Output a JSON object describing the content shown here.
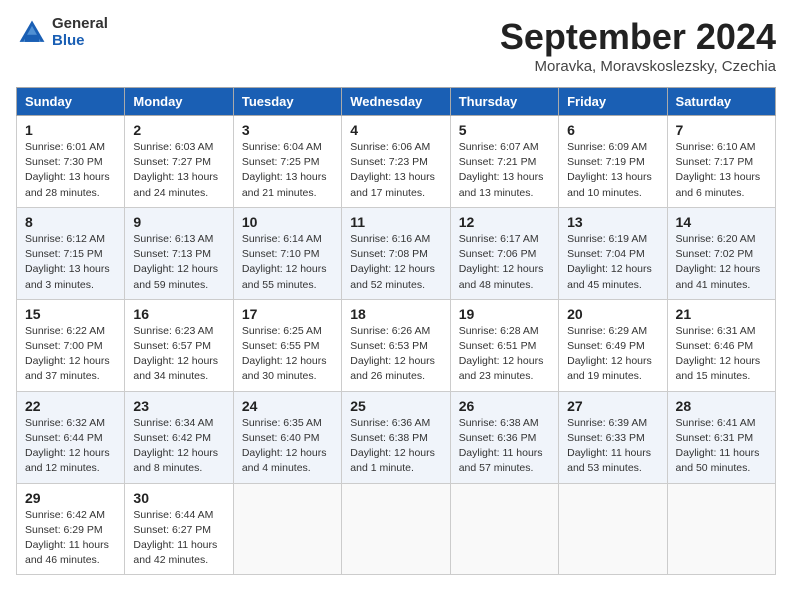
{
  "header": {
    "logo": {
      "general": "General",
      "blue": "Blue"
    },
    "title": "September 2024",
    "location": "Moravka, Moravskoslezsky, Czechia"
  },
  "weekdays": [
    "Sunday",
    "Monday",
    "Tuesday",
    "Wednesday",
    "Thursday",
    "Friday",
    "Saturday"
  ],
  "weeks": [
    [
      {
        "day": "1",
        "info": "Sunrise: 6:01 AM\nSunset: 7:30 PM\nDaylight: 13 hours\nand 28 minutes."
      },
      {
        "day": "2",
        "info": "Sunrise: 6:03 AM\nSunset: 7:27 PM\nDaylight: 13 hours\nand 24 minutes."
      },
      {
        "day": "3",
        "info": "Sunrise: 6:04 AM\nSunset: 7:25 PM\nDaylight: 13 hours\nand 21 minutes."
      },
      {
        "day": "4",
        "info": "Sunrise: 6:06 AM\nSunset: 7:23 PM\nDaylight: 13 hours\nand 17 minutes."
      },
      {
        "day": "5",
        "info": "Sunrise: 6:07 AM\nSunset: 7:21 PM\nDaylight: 13 hours\nand 13 minutes."
      },
      {
        "day": "6",
        "info": "Sunrise: 6:09 AM\nSunset: 7:19 PM\nDaylight: 13 hours\nand 10 minutes."
      },
      {
        "day": "7",
        "info": "Sunrise: 6:10 AM\nSunset: 7:17 PM\nDaylight: 13 hours\nand 6 minutes."
      }
    ],
    [
      {
        "day": "8",
        "info": "Sunrise: 6:12 AM\nSunset: 7:15 PM\nDaylight: 13 hours\nand 3 minutes."
      },
      {
        "day": "9",
        "info": "Sunrise: 6:13 AM\nSunset: 7:13 PM\nDaylight: 12 hours\nand 59 minutes."
      },
      {
        "day": "10",
        "info": "Sunrise: 6:14 AM\nSunset: 7:10 PM\nDaylight: 12 hours\nand 55 minutes."
      },
      {
        "day": "11",
        "info": "Sunrise: 6:16 AM\nSunset: 7:08 PM\nDaylight: 12 hours\nand 52 minutes."
      },
      {
        "day": "12",
        "info": "Sunrise: 6:17 AM\nSunset: 7:06 PM\nDaylight: 12 hours\nand 48 minutes."
      },
      {
        "day": "13",
        "info": "Sunrise: 6:19 AM\nSunset: 7:04 PM\nDaylight: 12 hours\nand 45 minutes."
      },
      {
        "day": "14",
        "info": "Sunrise: 6:20 AM\nSunset: 7:02 PM\nDaylight: 12 hours\nand 41 minutes."
      }
    ],
    [
      {
        "day": "15",
        "info": "Sunrise: 6:22 AM\nSunset: 7:00 PM\nDaylight: 12 hours\nand 37 minutes."
      },
      {
        "day": "16",
        "info": "Sunrise: 6:23 AM\nSunset: 6:57 PM\nDaylight: 12 hours\nand 34 minutes."
      },
      {
        "day": "17",
        "info": "Sunrise: 6:25 AM\nSunset: 6:55 PM\nDaylight: 12 hours\nand 30 minutes."
      },
      {
        "day": "18",
        "info": "Sunrise: 6:26 AM\nSunset: 6:53 PM\nDaylight: 12 hours\nand 26 minutes."
      },
      {
        "day": "19",
        "info": "Sunrise: 6:28 AM\nSunset: 6:51 PM\nDaylight: 12 hours\nand 23 minutes."
      },
      {
        "day": "20",
        "info": "Sunrise: 6:29 AM\nSunset: 6:49 PM\nDaylight: 12 hours\nand 19 minutes."
      },
      {
        "day": "21",
        "info": "Sunrise: 6:31 AM\nSunset: 6:46 PM\nDaylight: 12 hours\nand 15 minutes."
      }
    ],
    [
      {
        "day": "22",
        "info": "Sunrise: 6:32 AM\nSunset: 6:44 PM\nDaylight: 12 hours\nand 12 minutes."
      },
      {
        "day": "23",
        "info": "Sunrise: 6:34 AM\nSunset: 6:42 PM\nDaylight: 12 hours\nand 8 minutes."
      },
      {
        "day": "24",
        "info": "Sunrise: 6:35 AM\nSunset: 6:40 PM\nDaylight: 12 hours\nand 4 minutes."
      },
      {
        "day": "25",
        "info": "Sunrise: 6:36 AM\nSunset: 6:38 PM\nDaylight: 12 hours\nand 1 minute."
      },
      {
        "day": "26",
        "info": "Sunrise: 6:38 AM\nSunset: 6:36 PM\nDaylight: 11 hours\nand 57 minutes."
      },
      {
        "day": "27",
        "info": "Sunrise: 6:39 AM\nSunset: 6:33 PM\nDaylight: 11 hours\nand 53 minutes."
      },
      {
        "day": "28",
        "info": "Sunrise: 6:41 AM\nSunset: 6:31 PM\nDaylight: 11 hours\nand 50 minutes."
      }
    ],
    [
      {
        "day": "29",
        "info": "Sunrise: 6:42 AM\nSunset: 6:29 PM\nDaylight: 11 hours\nand 46 minutes."
      },
      {
        "day": "30",
        "info": "Sunrise: 6:44 AM\nSunset: 6:27 PM\nDaylight: 11 hours\nand 42 minutes."
      },
      {
        "day": "",
        "info": ""
      },
      {
        "day": "",
        "info": ""
      },
      {
        "day": "",
        "info": ""
      },
      {
        "day": "",
        "info": ""
      },
      {
        "day": "",
        "info": ""
      }
    ]
  ]
}
